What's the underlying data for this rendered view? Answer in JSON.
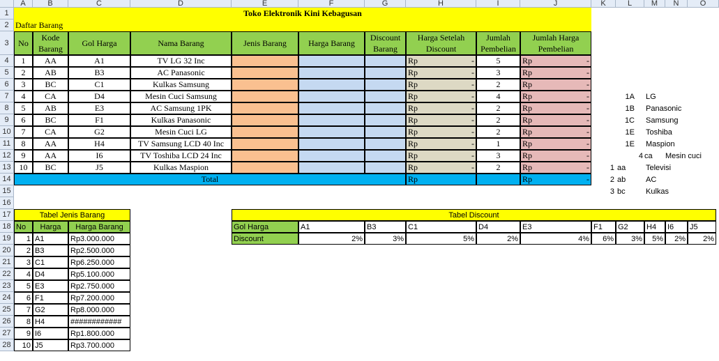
{
  "columns": [
    "A",
    "B",
    "C",
    "D",
    "E",
    "F",
    "G",
    "H",
    "I",
    "J",
    "K",
    "L",
    "M",
    "N",
    "O"
  ],
  "rows": [
    "1",
    "2",
    "3",
    "4",
    "5",
    "6",
    "7",
    "8",
    "9",
    "10",
    "11",
    "12",
    "13",
    "14",
    "15",
    "16",
    "17",
    "18",
    "19",
    "20",
    "21",
    "22",
    "23",
    "24",
    "25",
    "26",
    "27",
    "28"
  ],
  "title": "Toko Elektronik Kini Kebagusan",
  "subtitle": "Daftar Barang",
  "headers": [
    "No",
    "Kode Barang",
    "Gol Harga",
    "Nama Barang",
    "Jenis Barang",
    "Harga Barang",
    "Discount Barang",
    "Harga Setelah Discount",
    "Jumlah Pembelian",
    "Jumlah Harga Pembelian"
  ],
  "items": [
    {
      "no": "1",
      "kode": "AA",
      "gol": "A1",
      "nama": "TV LG 32 Inc",
      "jumlah": "5"
    },
    {
      "no": "2",
      "kode": "AB",
      "gol": "B3",
      "nama": "AC Panasonic",
      "jumlah": "3"
    },
    {
      "no": "3",
      "kode": "BC",
      "gol": "C1",
      "nama": "Kulkas Samsung",
      "jumlah": "2"
    },
    {
      "no": "4",
      "kode": "CA",
      "gol": "D4",
      "nama": "Mesin Cuci Samsung",
      "jumlah": "4"
    },
    {
      "no": "5",
      "kode": "AB",
      "gol": "E3",
      "nama": "AC Samsung 1PK",
      "jumlah": "2"
    },
    {
      "no": "6",
      "kode": "BC",
      "gol": "F1",
      "nama": "Kulkas Panasonic",
      "jumlah": "2"
    },
    {
      "no": "7",
      "kode": "CA",
      "gol": "G2",
      "nama": "Mesin Cuci LG",
      "jumlah": "2"
    },
    {
      "no": "8",
      "kode": "AA",
      "gol": "H4",
      "nama": "TV Samsung LCD 40 Inc",
      "jumlah": "1"
    },
    {
      "no": "9",
      "kode": "AA",
      "gol": "I6",
      "nama": "TV Toshiba LCD 24 Inc",
      "jumlah": "3"
    },
    {
      "no": "10",
      "kode": "BC",
      "gol": "J5",
      "nama": "Kulkas Maspion",
      "jumlah": "2"
    }
  ],
  "currency": "Rp",
  "dash": "-",
  "total_label": "Total",
  "side_list": [
    {
      "code": "1A",
      "name": "LG"
    },
    {
      "code": "1B",
      "name": "Panasonic"
    },
    {
      "code": "1C",
      "name": "Samsung"
    },
    {
      "code": "1E",
      "name": "Toshiba"
    },
    {
      "code": "1E",
      "name": "Maspion"
    },
    {
      "num": "4",
      "code": "ca",
      "name": "Mesin cuci"
    },
    {
      "num": "1",
      "code": "aa",
      "name": "Televisi"
    },
    {
      "num": "2",
      "code": "ab",
      "name": "AC"
    },
    {
      "num": "3",
      "code": "bc",
      "name": "Kulkas"
    }
  ],
  "jenis_table": {
    "title": "Tabel Jenis Barang",
    "headers": [
      "No",
      "Harga",
      "Harga Barang"
    ],
    "rows": [
      {
        "no": "1",
        "gol": "A1",
        "harga": "Rp3.000.000"
      },
      {
        "no": "2",
        "gol": "B3",
        "harga": "Rp2.500.000"
      },
      {
        "no": "3",
        "gol": "C1",
        "harga": "Rp6.250.000"
      },
      {
        "no": "4",
        "gol": "D4",
        "harga": "Rp5.100.000"
      },
      {
        "no": "5",
        "gol": "E3",
        "harga": "Rp2.750.000"
      },
      {
        "no": "6",
        "gol": "F1",
        "harga": "Rp7.200.000"
      },
      {
        "no": "7",
        "gol": "G2",
        "harga": "Rp8.000.000"
      },
      {
        "no": "8",
        "gol": "H4",
        "harga": "############"
      },
      {
        "no": "9",
        "gol": "I6",
        "harga": "Rp1.800.000"
      },
      {
        "no": "10",
        "gol": "J5",
        "harga": "Rp3.700.000"
      }
    ]
  },
  "discount_table": {
    "title": "Tabel Discount",
    "row1_label": "Gol Harga",
    "row2_label": "Discount",
    "codes": [
      "A1",
      "B3",
      "C1",
      "D4",
      "E3",
      "F1",
      "G2",
      "H4",
      "I6",
      "J5"
    ],
    "values": [
      "2%",
      "3%",
      "5%",
      "2%",
      "4%",
      "6%",
      "3%",
      "5%",
      "2%",
      "2%"
    ]
  }
}
